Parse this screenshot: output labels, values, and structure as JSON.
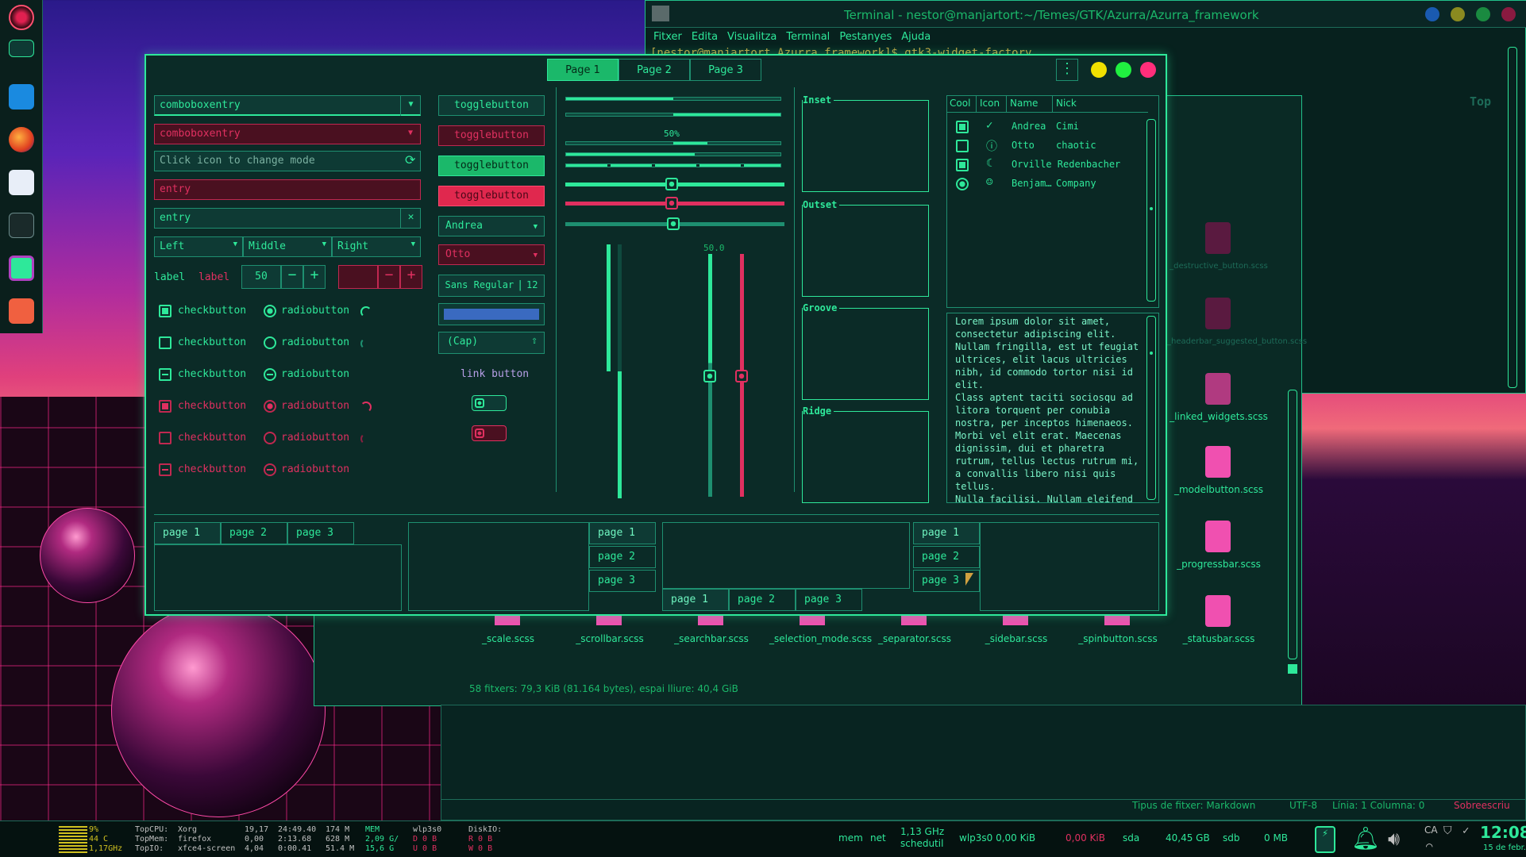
{
  "terminal": {
    "title": "Terminal - nestor@manjartort:~/Temes/GTK/Azurra/Azurra_framework",
    "menu": [
      "Fitxer",
      "Edita",
      "Visualitza",
      "Terminal",
      "Pestanyes",
      "Ajuda"
    ],
    "prompt": "[nestor@manjartort Azurra_framework]$ gtk3-widget-factory"
  },
  "files": {
    "icons_col": [
      "_destructive_button.scss",
      "_headerbar_suggested_button.scss",
      "_linked_widgets.scss",
      "_modelbutton.scss",
      "_progressbar.scss",
      "_statusbar.scss"
    ],
    "icons_row": [
      "_scale.scss",
      "_scrollbar.scss",
      "_searchbar.scss",
      "_selection_mode.scss",
      "_separator.scss",
      "_sidebar.scss",
      "_spinbutton.scss"
    ],
    "status": "58 fitxers: 79,3 KiB (81.164 bytes), espai lliure: 40,4 GiB"
  },
  "editor": {
    "status": [
      "Tipus de fitxer: Markdown",
      "UTF-8",
      "Línia: 1 Columna: 0",
      "Sobreescriu"
    ],
    "top_label": "Top"
  },
  "factory": {
    "header_tabs": [
      "Page 1",
      "Page 2",
      "Page 3"
    ],
    "combo1": "comboboxentry",
    "combo2": "comboboxentry",
    "entry_mode": "Click icon to change mode",
    "entry_red": "entry",
    "entry_clear": "entry",
    "combos3": [
      "Left",
      "Middle",
      "Right"
    ],
    "label1": "label",
    "label2": "label",
    "spin_value": "50",
    "checks": [
      "checkbutton",
      "checkbutton",
      "checkbutton",
      "checkbutton",
      "checkbutton",
      "checkbutton"
    ],
    "radios": [
      "radiobutton",
      "radiobutton",
      "radiobutton",
      "radiobutton",
      "radiobutton",
      "radiobutton"
    ],
    "toggles": [
      "togglebutton",
      "togglebutton",
      "togglebutton",
      "togglebutton"
    ],
    "combo_andrea": "Andrea",
    "combo_otto": "Otto",
    "font_btn": "Sans Regular",
    "font_size": "12",
    "file_btn": "(Cap)",
    "link": "link button",
    "progress_label": "50%",
    "scale_label": "50.0",
    "frames": [
      "Inset",
      "Outset",
      "Groove",
      "Ridge"
    ],
    "tree_headers": [
      "Cool",
      "Icon",
      "Name",
      "Nick"
    ],
    "tree_rows": [
      {
        "name": "Andrea",
        "nick": "Cimi"
      },
      {
        "name": "Otto",
        "nick": "chaotic"
      },
      {
        "name": "Orville Redenbacher",
        "nick": ""
      },
      {
        "name": "Benjam…",
        "nick": "Company"
      }
    ],
    "lorem": "Lorem ipsum dolor sit amet,\nconsectetur adipiscing elit.\nNullam fringilla, est ut feugiat\nultrices, elit lacus ultricies\nnibh, id commodo tortor nisi id\nelit.\nClass aptent taciti sociosqu ad\nlitora torquent per conubia\nnostra, per inceptos himenaeos.\nMorbi vel elit erat. Maecenas\ndignissim, dui et pharetra\nrutrum, tellus lectus rutrum mi,\na convallis libero nisi quis\ntellus.\nNulla facilisi. Nullam eleifend",
    "nb1": [
      "page 1",
      "page 2",
      "page 3"
    ],
    "nb2": [
      "page 1",
      "page 2",
      "page 3"
    ],
    "nb3": [
      "page 1",
      "page 2",
      "page 3"
    ],
    "nb4": [
      "page 1",
      "page 2",
      "page 3"
    ]
  },
  "conky": {
    "cpu": [
      "9%",
      "44 C",
      "1,17GHz"
    ],
    "top_labels": [
      "TopCPU:",
      "TopMem:",
      "TopIO:"
    ],
    "top_procs": [
      "Xorg",
      "firefox",
      "xfce4-screen"
    ],
    "top_vals": [
      "19,17",
      "0,00",
      "4,04"
    ],
    "top_times": [
      "24:49.40",
      "2:13.68",
      "0:00.41"
    ],
    "top_mem": [
      "174 M",
      "628 M",
      "51.4 M"
    ],
    "mem": [
      "MEM",
      "2,09 G/",
      "15,6 G"
    ],
    "net": [
      "wlp3s0",
      "D 0 B",
      "U 0 B"
    ],
    "disk": [
      "DiskIO:",
      "R 0 B",
      "W 0 B"
    ]
  },
  "panel": {
    "mem": "mem",
    "net": "net",
    "freq": "1,13 GHz",
    "gov": "schedutil",
    "iface": "wlp3s0 0,00 KiB",
    "down": "0,00 KiB",
    "sda": "sda",
    "sda_size": "40,45 GB",
    "sdb": "sdb",
    "sdb_size": "0 MB",
    "lang": "CA",
    "time": "12:08",
    "date": "15 de febr."
  },
  "colors": {
    "accent": "#2ee89a",
    "danger": "#e03060",
    "bg": "#0b2b27"
  }
}
